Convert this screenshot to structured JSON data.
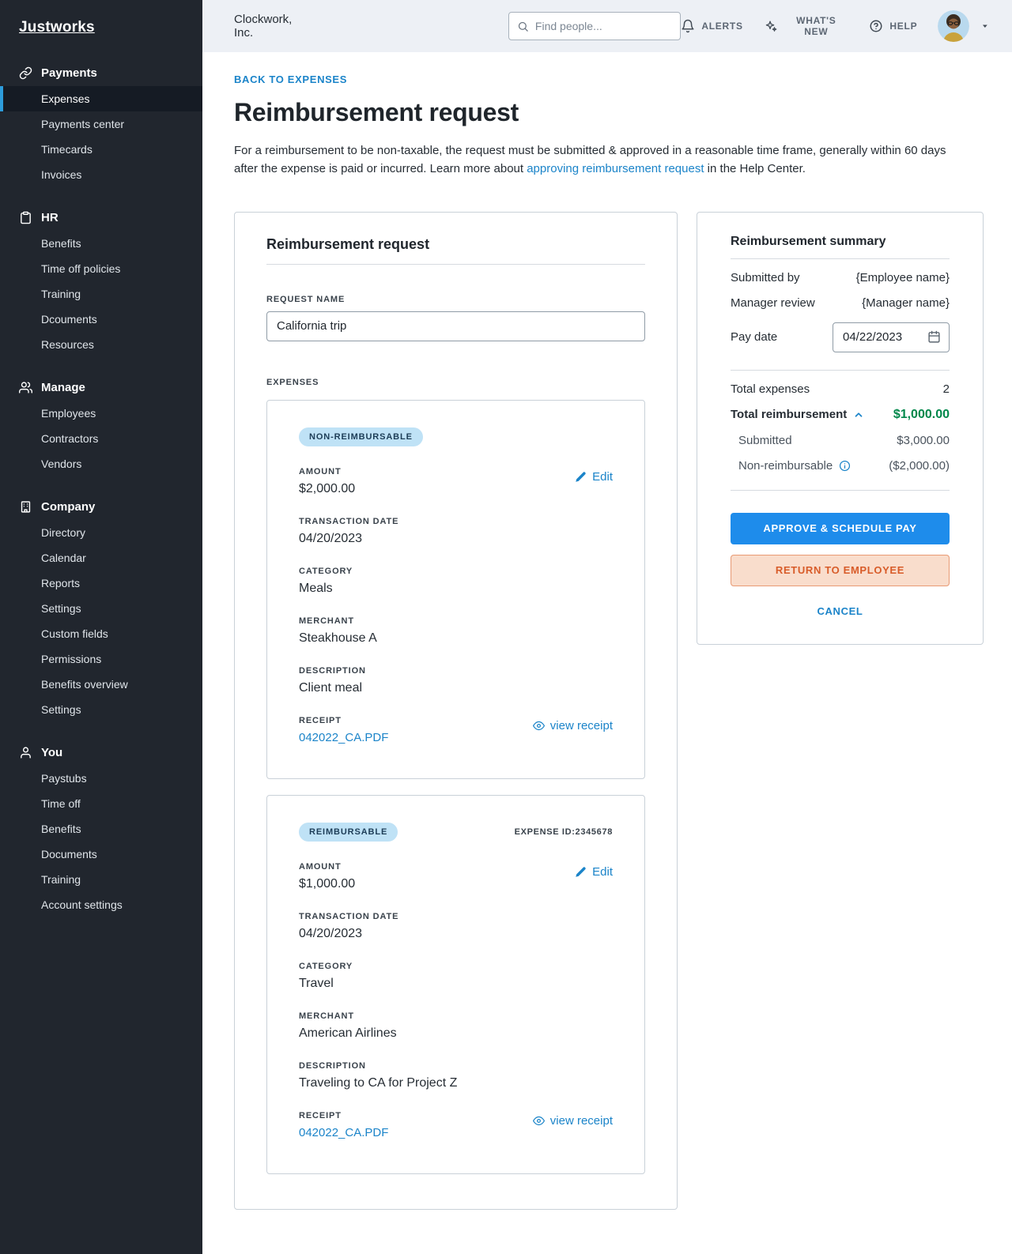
{
  "colors": {
    "link-blue": "#1b84c9",
    "btn-blue": "#1e8ceb",
    "accent-blue": "#2d9cdb",
    "green": "#00874a",
    "badge-bg": "#bfe2f6",
    "badge-text": "#1d3d57",
    "sidebar-bg": "#21262e",
    "return-bg": "#f9ddcc",
    "return-border": "#e89a74",
    "return-text": "#d85c29",
    "topbar-bg": "#edf0f5"
  },
  "sidebar": {
    "logo": "Justworks",
    "sections": [
      {
        "label": "Payments",
        "items": [
          {
            "label": "Expenses"
          },
          {
            "label": "Payments center"
          },
          {
            "label": "Timecards"
          },
          {
            "label": "Invoices"
          }
        ]
      },
      {
        "label": "HR",
        "items": [
          {
            "label": "Benefits"
          },
          {
            "label": "Time off policies"
          },
          {
            "label": "Training"
          },
          {
            "label": "Dcouments"
          },
          {
            "label": "Resources"
          }
        ]
      },
      {
        "label": "Manage",
        "items": [
          {
            "label": "Employees"
          },
          {
            "label": "Contractors"
          },
          {
            "label": "Vendors"
          }
        ]
      },
      {
        "label": "Company",
        "items": [
          {
            "label": "Directory"
          },
          {
            "label": "Calendar"
          },
          {
            "label": "Reports"
          },
          {
            "label": "Settings"
          },
          {
            "label": "Custom fields"
          },
          {
            "label": "Permissions"
          },
          {
            "label": "Benefits overview"
          },
          {
            "label": "Settings"
          }
        ]
      },
      {
        "label": "You",
        "items": [
          {
            "label": "Paystubs"
          },
          {
            "label": "Time off"
          },
          {
            "label": "Benefits"
          },
          {
            "label": "Documents"
          },
          {
            "label": "Training"
          },
          {
            "label": "Account settings"
          }
        ]
      }
    ]
  },
  "topbar": {
    "company": "Clockwork, Inc.",
    "search_placeholder": "Find people...",
    "alerts_label": "ALERTS",
    "whats_new_label": "WHAT'S NEW",
    "help_label": "HELP"
  },
  "page": {
    "back_link": "BACK TO EXPENSES",
    "title": "Reimbursement request",
    "intro_before": "For a reimbursement to be non-taxable, the request must be submitted & approved in a reasonable time frame, generally within 60 days after the expense is paid or incurred.  Learn more about ",
    "intro_link": "approving reimbursement request",
    "intro_after": " in the Help Center."
  },
  "request_card": {
    "title": "Reimbursement request",
    "request_name_label": "REQUEST NAME",
    "request_name_value": "California trip",
    "expenses_label": "EXPENSES",
    "edit_label": "Edit",
    "view_receipt_label": "view receipt",
    "labels": {
      "amount": "AMOUNT",
      "transaction_date": "TRANSACTION DATE",
      "category": "CATEGORY",
      "merchant": "MERCHANT",
      "description": "DESCRIPTION",
      "receipt": "RECEIPT"
    },
    "expenses": [
      {
        "badge": "NON-REIMBURSABLE",
        "expense_id": "",
        "amount": "$2,000.00",
        "transaction_date": "04/20/2023",
        "category": "Meals",
        "merchant": "Steakhouse A",
        "description": "Client meal",
        "receipt_file": "042022_CA.PDF"
      },
      {
        "badge": "REIMBURSABLE",
        "expense_id": "EXPENSE ID:2345678",
        "amount": "$1,000.00",
        "transaction_date": "04/20/2023",
        "category": "Travel",
        "merchant": "American Airlines",
        "description": "Traveling to CA for Project Z",
        "receipt_file": "042022_CA.PDF"
      }
    ]
  },
  "summary": {
    "title": "Reimbursement summary",
    "submitted_by_label": "Submitted by",
    "submitted_by_value": "{Employee name}",
    "manager_review_label": "Manager review",
    "manager_review_value": "{Manager name}",
    "pay_date_label": "Pay date",
    "pay_date_value": "04/22/2023",
    "total_expenses_label": "Total expenses",
    "total_expenses_value": "2",
    "total_reimbursement_label": "Total reimbursement",
    "total_reimbursement_value": "$1,000.00",
    "submitted_label": "Submitted",
    "submitted_value": "$3,000.00",
    "non_reimbursable_label": "Non-reimbursable",
    "non_reimbursable_value": "($2,000.00)",
    "approve_button": "APPROVE & SCHEDULE PAY",
    "return_button": "RETURN TO EMPLOYEE",
    "cancel_label": "CANCEL"
  }
}
